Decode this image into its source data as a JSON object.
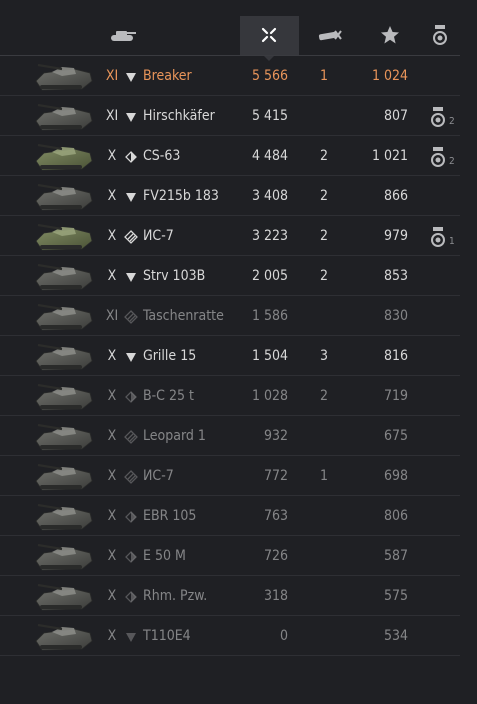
{
  "header": {
    "columns": [
      {
        "icon": "tank-icon"
      },
      {
        "icon": "damage-icon",
        "active": true
      },
      {
        "icon": "kills-icon"
      },
      {
        "icon": "experience-star-icon"
      },
      {
        "icon": "medal-icon"
      }
    ]
  },
  "rows": [
    {
      "tier": "XI",
      "cls": "heavy",
      "name": "Breaker",
      "dmg": "5 566",
      "kills": "1",
      "xp": "1 024",
      "medal": "",
      "premium": true,
      "dim": false
    },
    {
      "tier": "XI",
      "cls": "heavy",
      "name": "Hirschkäfer",
      "dmg": "5 415",
      "kills": "",
      "xp": "807",
      "medal": "2",
      "premium": false,
      "dim": false
    },
    {
      "tier": "X",
      "cls": "light",
      "name": "CS-63",
      "dmg": "4 484",
      "kills": "2",
      "xp": "1 021",
      "medal": "2",
      "premium": false,
      "dim": false
    },
    {
      "tier": "X",
      "cls": "heavy",
      "name": "FV215b 183",
      "dmg": "3 408",
      "kills": "2",
      "xp": "866",
      "medal": "",
      "premium": false,
      "dim": false
    },
    {
      "tier": "X",
      "cls": "medium",
      "name": "ИС-7",
      "dmg": "3 223",
      "kills": "2",
      "xp": "979",
      "medal": "1",
      "premium": false,
      "dim": false
    },
    {
      "tier": "X",
      "cls": "heavy",
      "name": "Strv 103B",
      "dmg": "2 005",
      "kills": "2",
      "xp": "853",
      "medal": "",
      "premium": false,
      "dim": false
    },
    {
      "tier": "XI",
      "cls": "medium",
      "name": "Taschenratte",
      "dmg": "1 586",
      "kills": "",
      "xp": "830",
      "medal": "",
      "premium": false,
      "dim": true
    },
    {
      "tier": "X",
      "cls": "heavy",
      "name": "Grille 15",
      "dmg": "1 504",
      "kills": "3",
      "xp": "816",
      "medal": "",
      "premium": false,
      "dim": false
    },
    {
      "tier": "X",
      "cls": "light",
      "name": "B-C 25 t",
      "dmg": "1 028",
      "kills": "2",
      "xp": "719",
      "medal": "",
      "premium": false,
      "dim": true
    },
    {
      "tier": "X",
      "cls": "medium",
      "name": "Leopard 1",
      "dmg": "932",
      "kills": "",
      "xp": "675",
      "medal": "",
      "premium": false,
      "dim": true
    },
    {
      "tier": "X",
      "cls": "medium",
      "name": "ИС-7",
      "dmg": "772",
      "kills": "1",
      "xp": "698",
      "medal": "",
      "premium": false,
      "dim": true
    },
    {
      "tier": "X",
      "cls": "light",
      "name": "EBR 105",
      "dmg": "763",
      "kills": "",
      "xp": "806",
      "medal": "",
      "premium": false,
      "dim": true
    },
    {
      "tier": "X",
      "cls": "light",
      "name": "E 50 M",
      "dmg": "726",
      "kills": "",
      "xp": "587",
      "medal": "",
      "premium": false,
      "dim": true
    },
    {
      "tier": "X",
      "cls": "light",
      "name": "Rhm. Pzw.",
      "dmg": "318",
      "kills": "",
      "xp": "575",
      "medal": "",
      "premium": false,
      "dim": true
    },
    {
      "tier": "X",
      "cls": "heavy",
      "name": "T110E4",
      "dmg": "0",
      "kills": "",
      "xp": "534",
      "medal": "",
      "premium": false,
      "dim": true
    }
  ]
}
